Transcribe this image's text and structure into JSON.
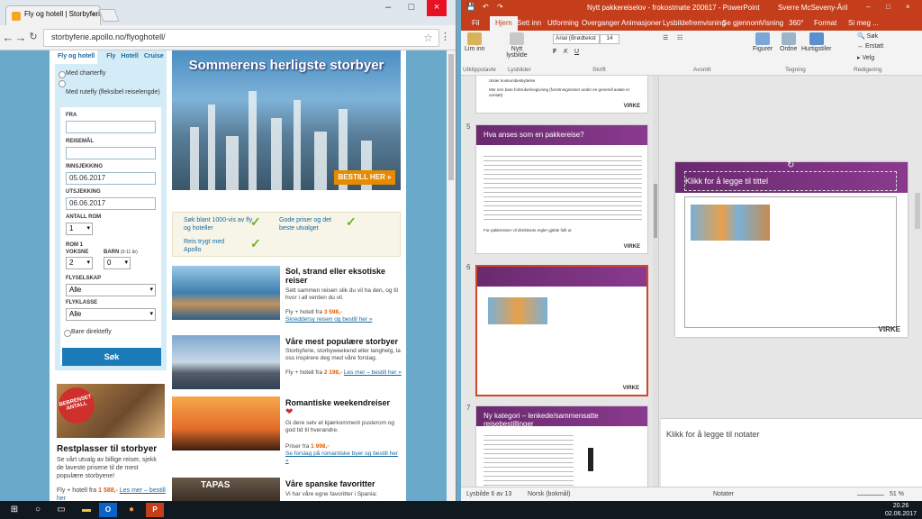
{
  "browser": {
    "tab_title": "Fly og hotell | Storbyferie",
    "url": "storbyferie.apollo.no/flyoghotell/",
    "booking": {
      "tabs": [
        "Fly og hotell",
        "Fly",
        "Hotell",
        "Cruise"
      ],
      "radio1": "Med charterfly",
      "radio2": "Med rutefly (fleksibel reiselengde)",
      "fra": "FRA",
      "reisemal": "REISEMÅL",
      "innsjekking": "INNSJEKKING",
      "innsjekking_val": "05.06.2017",
      "utsjekking": "UTSJEKKING",
      "utsjekking_val": "06.06.2017",
      "antall_rom": "ANTALL ROM",
      "rom_val": "1",
      "rom1": "ROM 1",
      "voksne": "VOKSNE",
      "voksne_val": "2",
      "barn": "BARN",
      "barn_note": "(0-11 år)",
      "barn_val": "0",
      "flyselskap": "FLYSELSKAP",
      "alle": "Alle",
      "flyklasse": "FLYKLASSE",
      "direkte": "Bare direktefly",
      "sok": "Søk"
    },
    "promo": {
      "badge": "BEBRENSET ANTALL",
      "title": "Restplasser til storbyer",
      "text": "Se vårt utvalg av billige reiser, sjekk de laveste prisene til de mest populære storbyene!",
      "price_pre": "Fly + hotell fra ",
      "price": "1 588,-",
      "link": "Les mer – bestill her"
    },
    "hero": {
      "title": "Sommerens herligste storbyer",
      "button": "BESTILL HER »"
    },
    "usp": [
      "Søk blant 1000-vis av fly og hoteller",
      "Gode priser og det beste utvalget",
      "Reis trygt med Apollo"
    ],
    "items": [
      {
        "title": "Sol, strand eller eksotiske reiser",
        "text": "Sett sammen reisen slik du vil ha den, og til hvor i all verden du vil.",
        "price_pre": "Fly + hotell fra ",
        "price": "3 598,-",
        "link": "Skreddersy reisen og bestill her »"
      },
      {
        "title": "Våre mest populære storbyer",
        "text": "Storbyferie, storbyweekend eller langhelg, la oss inspirere deg med våre forslag.",
        "price_pre": "Fly + hotell fra ",
        "price": "2 198,-",
        "link": "Les mer – bestill her »"
      },
      {
        "title": "Romantiske weekendreiser",
        "text": "Gi dere selv et kjærkomment pusterom og god tid til hverandre.",
        "price_pre": "Priser fra ",
        "price": "1 998,-",
        "link": "Se forslag på romantiske byer og bestill her »"
      },
      {
        "title": "Våre spanske favoritter",
        "text": "Vi har våre egne favoritter i Spania;",
        "img_text": "TAPAS"
      }
    ]
  },
  "ppt": {
    "title": "Nytt pakkereiselov - frokostmøte 200617 - PowerPoint",
    "user": "Sverre McSeveny-Åril",
    "tabs": [
      "Fil",
      "Hjem",
      "Sett inn",
      "Utforming",
      "Overganger",
      "Animasjoner",
      "Lysbildefremvisning",
      "Se gjennom",
      "Visning",
      "360°",
      "Format",
      "Si meg ..."
    ],
    "ribbon": {
      "lim_inn": "Lim inn",
      "nytt": "Nytt lysbilde",
      "font": "Arial (Brødtekst",
      "size": "14",
      "figurer": "Figurer",
      "ordne": "Ordne",
      "hurtigstiler": "Hurtigstiler",
      "sok": "Søk",
      "erstatt": "Erstatt",
      "velg": "Velg",
      "groups": [
        "Utklippstavle",
        "Lysbilder",
        "Skrift",
        "Avsnitt",
        "Tegning",
        "Redigering"
      ]
    },
    "slide4_lines": [
      "Utsier konkursbeskyttelse",
      "Mer enn bare forbrukerlovgivning (forretningsreiser under en generell avtale er unntatt)"
    ],
    "slide5_title": "Hva anses som en pakkereise?",
    "slide5_footer": "For pakkereiser vil direktivets regler gjelde fullt ut",
    "slide7_title": "Ny kategori – lenkede/sammensatte reisebestillinger",
    "slide_nums": [
      "5",
      "6",
      "7"
    ],
    "virke": "VIRKE",
    "editor_title": "Klikk for å legge til tittel",
    "notes": "Klikk for å legge til notater",
    "status": {
      "slide": "Lysbilde 6 av 13",
      "lang": "Norsk (bokmål)",
      "notater": "Notater",
      "zoom": "51 %"
    }
  },
  "taskbar": {
    "time": "20.26",
    "date": "02.06.2017"
  }
}
